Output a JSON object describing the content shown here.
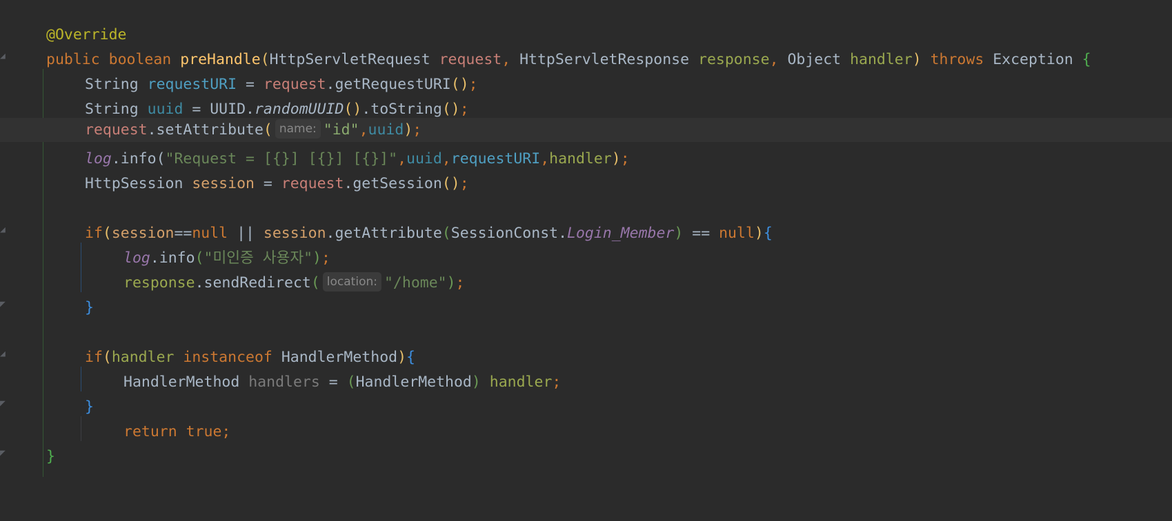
{
  "editor": {
    "lines": [
      {
        "text": "@Override"
      },
      {
        "text": "public boolean preHandle(HttpServletRequest request, HttpServletResponse response, Object handler) throws Exception {"
      },
      {
        "text": "String requestURI = request.getRequestURI();"
      },
      {
        "text": "String uuid = UUID.randomUUID().toString();"
      },
      {
        "text": "request.setAttribute( name: \"id\",uuid);"
      },
      {
        "text": "log.info(\"Request = [{}] [{}] [{}]\",uuid,requestURI,handler);"
      },
      {
        "text": "HttpSession session = request.getSession();"
      },
      {
        "text": ""
      },
      {
        "text": "if(session==null || session.getAttribute(SessionConst.Login_Member) == null){"
      },
      {
        "text": "log.info(\"미인증 사용자\");"
      },
      {
        "text": "response.sendRedirect( location: \"/home\");"
      },
      {
        "text": "}"
      },
      {
        "text": ""
      },
      {
        "text": "if(handler instanceof HandlerMethod){"
      },
      {
        "text": "HandlerMethod handlers = (HandlerMethod) handler;"
      },
      {
        "text": "}"
      },
      {
        "text": "return true;"
      },
      {
        "text": "}"
      }
    ],
    "tokens": {
      "l0": [
        "@Override"
      ],
      "l1": [
        "public",
        " ",
        "boolean",
        " ",
        "preHandle",
        "(",
        "HttpServletRequest",
        " ",
        "request",
        ", ",
        "HttpServletResponse",
        " ",
        "response",
        ", ",
        "Object",
        " ",
        "handler",
        ")",
        " ",
        "throws",
        " ",
        "Exception",
        " ",
        "{"
      ],
      "l2": [
        "String",
        " ",
        "requestURI",
        " = ",
        "request",
        ".getRequestURI",
        "()",
        ";"
      ],
      "l3": [
        "String",
        " ",
        "uuid",
        " = UUID.",
        "randomUUID",
        "()",
        ".toString",
        "()",
        ";"
      ],
      "l4": [
        "request",
        ".setAttribute",
        "(",
        "name:",
        "\"id\"",
        ",",
        "uuid",
        ")",
        ";"
      ],
      "l5": [
        "log",
        ".info(",
        "\"Request = [{}] [{}] [{}]\"",
        ",",
        "uuid",
        ",",
        "requestURI",
        ",",
        "handler",
        ")",
        ";"
      ],
      "l6": [
        "HttpSession",
        " ",
        "session",
        " = ",
        "request",
        ".getSession",
        "()",
        ";"
      ],
      "l8": [
        "if",
        "(",
        "session",
        "==",
        "null",
        " || ",
        "session",
        ".getAttribute",
        "(",
        "SessionConst.",
        "Login_Member",
        ")",
        " == ",
        "null",
        ")",
        "{"
      ],
      "l9": [
        "log",
        ".info",
        "(",
        "\"미인증 사용자\"",
        ")",
        ";"
      ],
      "l10": [
        "response",
        ".sendRedirect",
        "(",
        "location:",
        "\"/home\"",
        ")",
        ";"
      ],
      "l11": [
        "}"
      ],
      "l13": [
        "if",
        "(",
        "handler",
        " ",
        "instanceof",
        " ",
        "HandlerMethod",
        ")",
        "{"
      ],
      "l14": [
        "HandlerMethod",
        " ",
        "handlers",
        " = ",
        "(",
        "HandlerMethod",
        ")",
        " ",
        "handler",
        ";"
      ],
      "l15": [
        "}"
      ],
      "l16": [
        "return",
        " ",
        "true",
        ";"
      ],
      "l17": [
        "}"
      ]
    },
    "colors": {
      "background": "#2b2b2b",
      "current_line": "#323232",
      "keyword": "#cc7832",
      "annotation": "#bbb529",
      "method": "#ffc66d",
      "string": "#6a8759",
      "field": "#4f9fc2",
      "static_field": "#9876aa",
      "parameter": "#c87f77",
      "default_text": "#a9b7c6"
    }
  }
}
